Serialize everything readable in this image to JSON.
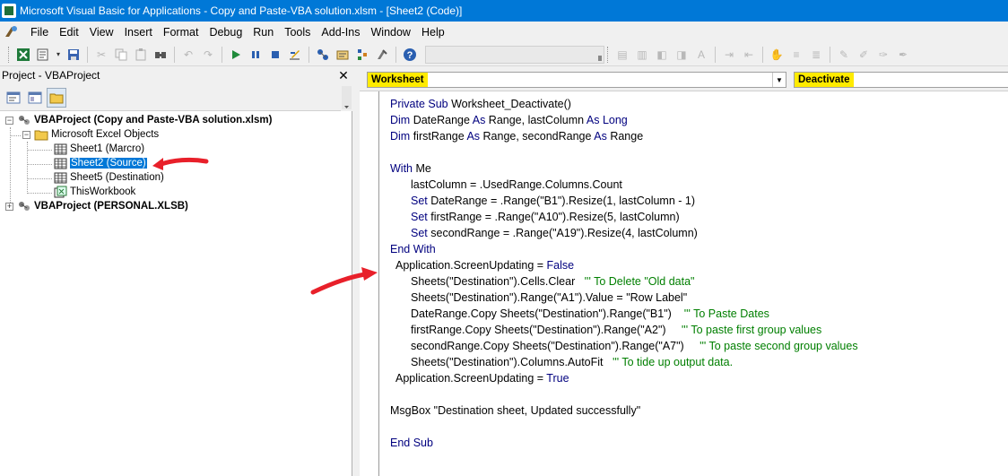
{
  "window": {
    "title": "Microsoft Visual Basic for Applications - Copy and Paste-VBA solution.xlsm - [Sheet2 (Code)]"
  },
  "menu": {
    "items": [
      {
        "label": "File",
        "mnemonic_underlined": true
      },
      {
        "label": "Edit"
      },
      {
        "label": "View"
      },
      {
        "label": "Insert"
      },
      {
        "label": "Format"
      },
      {
        "label": "Debug"
      },
      {
        "label": "Run"
      },
      {
        "label": "Tools"
      },
      {
        "label": "Add-Ins"
      },
      {
        "label": "Window"
      },
      {
        "label": "Help"
      }
    ]
  },
  "toolbar": {
    "icons": [
      "excel-icon",
      "insert-module-icon",
      "save-icon",
      "cut-icon",
      "copy-icon",
      "paste-icon",
      "find-icon",
      "undo-icon",
      "redo-icon",
      "run-icon",
      "break-icon",
      "reset-icon",
      "design-mode-icon",
      "project-explorer-icon",
      "properties-icon",
      "object-browser-icon",
      "toolbox-icon",
      "help-icon"
    ]
  },
  "project_pane": {
    "title": "Project - VBAProject",
    "close_glyph": "✕",
    "tree": [
      {
        "label": "VBAProject (Copy and Paste-VBA solution.xlsm)",
        "level": 0,
        "bold": true,
        "expander": "−"
      },
      {
        "label": "Microsoft Excel Objects",
        "level": 1,
        "expander": "−"
      },
      {
        "label": "Sheet1 (Marcro)",
        "level": 2
      },
      {
        "label": "Sheet2 (Source)",
        "level": 2,
        "selected": true
      },
      {
        "label": "Sheet5 (Destination)",
        "level": 2
      },
      {
        "label": "ThisWorkbook",
        "level": 2
      },
      {
        "label": "VBAProject (PERSONAL.XLSB)",
        "level": 0,
        "bold": true,
        "expander": "+"
      }
    ]
  },
  "code_window": {
    "object_combo": "Worksheet",
    "procedure_combo": "Deactivate",
    "highlight_color": "#ffeb00",
    "keyword_color": "#00007f",
    "comment_color": "#007f00",
    "lines": [
      {
        "indent": 0,
        "parts": [
          [
            "kw",
            "Private Sub "
          ],
          [
            "tx",
            "Worksheet_Deactivate()"
          ]
        ]
      },
      {
        "indent": 0,
        "parts": [
          [
            "kw",
            "Dim "
          ],
          [
            "tx",
            "DateRange "
          ],
          [
            "kw",
            "As "
          ],
          [
            "tx",
            "Range, lastColumn "
          ],
          [
            "kw",
            "As Long"
          ]
        ]
      },
      {
        "indent": 0,
        "parts": [
          [
            "kw",
            "Dim "
          ],
          [
            "tx",
            "firstRange "
          ],
          [
            "kw",
            "As "
          ],
          [
            "tx",
            "Range, secondRange "
          ],
          [
            "kw",
            "As "
          ],
          [
            "tx",
            "Range"
          ]
        ]
      },
      {
        "indent": 0,
        "parts": []
      },
      {
        "indent": 0,
        "parts": [
          [
            "kw",
            "With "
          ],
          [
            "tx",
            "Me"
          ]
        ]
      },
      {
        "indent": 2,
        "parts": [
          [
            "tx",
            "lastColumn = .UsedRange.Columns.Count"
          ]
        ]
      },
      {
        "indent": 2,
        "parts": [
          [
            "kw",
            "Set "
          ],
          [
            "tx",
            "DateRange = .Range(\"B1\").Resize(1, lastColumn - 1)"
          ]
        ]
      },
      {
        "indent": 2,
        "parts": [
          [
            "kw",
            "Set "
          ],
          [
            "tx",
            "firstRange = .Range(\"A10\").Resize(5, lastColumn)"
          ]
        ]
      },
      {
        "indent": 2,
        "parts": [
          [
            "kw",
            "Set "
          ],
          [
            "tx",
            "secondRange = .Range(\"A19\").Resize(4, lastColumn)"
          ]
        ]
      },
      {
        "indent": 0,
        "parts": [
          [
            "kw",
            "End With"
          ]
        ]
      },
      {
        "indent": 1,
        "parts": [
          [
            "tx",
            "Application.ScreenUpdating = "
          ],
          [
            "kw",
            "False"
          ]
        ]
      },
      {
        "indent": 2,
        "parts": [
          [
            "tx",
            "Sheets(\"Destination\").Cells.Clear   "
          ],
          [
            "cm",
            "''' To Delete \"Old data\""
          ]
        ]
      },
      {
        "indent": 2,
        "parts": [
          [
            "tx",
            "Sheets(\"Destination\").Range(\"A1\").Value = \"Row Label\""
          ]
        ]
      },
      {
        "indent": 2,
        "parts": [
          [
            "tx",
            "DateRange.Copy Sheets(\"Destination\").Range(\"B1\")    "
          ],
          [
            "cm",
            "''' To Paste Dates"
          ]
        ]
      },
      {
        "indent": 2,
        "parts": [
          [
            "tx",
            "firstRange.Copy Sheets(\"Destination\").Range(\"A2\")     "
          ],
          [
            "cm",
            "''' To paste first group values"
          ]
        ]
      },
      {
        "indent": 2,
        "parts": [
          [
            "tx",
            "secondRange.Copy Sheets(\"Destination\").Range(\"A7\")     "
          ],
          [
            "cm",
            "''' To paste second group values"
          ]
        ]
      },
      {
        "indent": 2,
        "parts": [
          [
            "tx",
            "Sheets(\"Destination\").Columns.AutoFit   "
          ],
          [
            "cm",
            "''' To tide up output data."
          ]
        ]
      },
      {
        "indent": 1,
        "parts": [
          [
            "tx",
            "Application.ScreenUpdating = "
          ],
          [
            "kw",
            "True"
          ]
        ]
      },
      {
        "indent": 0,
        "parts": []
      },
      {
        "indent": 0,
        "parts": [
          [
            "tx",
            "MsgBox \"Destination sheet, Updated successfully\""
          ]
        ]
      },
      {
        "indent": 0,
        "parts": []
      },
      {
        "indent": 0,
        "parts": [
          [
            "kw",
            "End Sub"
          ]
        ]
      }
    ]
  },
  "annotations": {
    "arrow_color": "#e8202a"
  }
}
